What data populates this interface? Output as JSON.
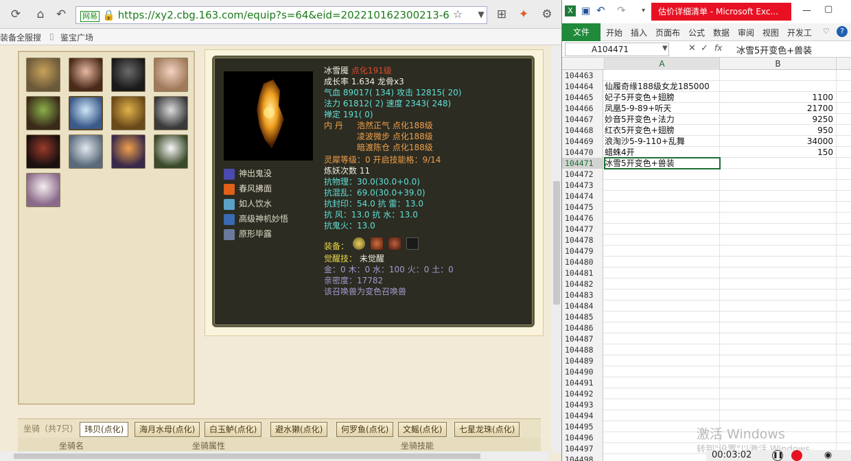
{
  "browser": {
    "url": "https://xy2.cbg.163.com/equip?s=64&eid=202210162300213-6",
    "url_badge": "网易",
    "bookmarks": [
      "装备全服搜",
      "鉴宝广场"
    ]
  },
  "pet": {
    "name": "冰雪魇",
    "level": "点化191级",
    "growth": "成长率 1.634 龙骨x3",
    "hp_label": "气血",
    "hp": "89017( 134)",
    "atk_label": "攻击",
    "atk": "12815( 20)",
    "mp_label": "法力",
    "mp": "61812( 2)",
    "spd_label": "速度",
    "spd": "2343( 248)",
    "zen": "禅定 191( 0)",
    "neidan_label": "内 丹",
    "neidan": [
      "浩然正气 点化188级",
      "凌波微步 点化188级",
      "暗渡陈仓 点化188级"
    ],
    "lingxi": "灵犀等级：0 开启技能格：9/14",
    "lianyao": "炼妖次数 11",
    "resist": [
      "抗物理：30.0(30.0+0.0)",
      "抗混乱：69.0(30.0+39.0)",
      "抗封印：54.0 抗  雷：13.0",
      "抗  风：13.0 抗  水：13.0",
      "抗鬼火：13.0"
    ],
    "equip_label": "装备：",
    "awaken_label": "觉醒技：",
    "awaken_value": "未觉醒",
    "elements": "金：0 木：0 水：100 火：0 土：0",
    "intimacy": "亲密度：17782",
    "note": "该召唤兽为变色召唤兽",
    "skills": [
      "神出鬼没",
      "春风拂面",
      "如人饮水",
      "高级神机妙悟",
      "原形毕露"
    ]
  },
  "mounts": {
    "header_title": "坐骑（共7只）",
    "tabs": [
      "玮贝(点化)",
      "海月水母(点化)",
      "白玉鲈(点化)",
      "避水獭(点化)",
      "何罗鱼(点化)",
      "文鳐(点化)",
      "七星龙珠(点化)"
    ],
    "columns": [
      "坐骑名",
      "坐骑属性",
      "坐骑技能"
    ]
  },
  "excel": {
    "title": "估价详细清单 - Microsoft Exc...",
    "ribbon": [
      "文件",
      "开始",
      "插入",
      "页面布",
      "公式",
      "数据",
      "审阅",
      "视图",
      "开发工"
    ],
    "name_box": "A104471",
    "formula": "冰雪5开变色+兽装",
    "col_a": "A",
    "col_b": "B",
    "rows": [
      {
        "n": "104463",
        "a": "",
        "b": ""
      },
      {
        "n": "104464",
        "a": "仙履奇缘188级女龙185000",
        "b": ""
      },
      {
        "n": "104465",
        "a": "妃子5开变色+翅膀",
        "b": "1100"
      },
      {
        "n": "104466",
        "a": "凤凰5-9-89+听天",
        "b": "21700"
      },
      {
        "n": "104467",
        "a": "妙音5开变色+法力",
        "b": "9250"
      },
      {
        "n": "104468",
        "a": "红衣5开变色+翅膀",
        "b": "950"
      },
      {
        "n": "104469",
        "a": "浪淘沙5-9-110+乱舞",
        "b": "34000"
      },
      {
        "n": "104470",
        "a": "蜡蛛4开",
        "b": "150"
      },
      {
        "n": "104471",
        "a": "冰雪5开变色+兽装",
        "b": ""
      },
      {
        "n": "104472",
        "a": "",
        "b": ""
      },
      {
        "n": "104473",
        "a": "",
        "b": ""
      },
      {
        "n": "104474",
        "a": "",
        "b": ""
      },
      {
        "n": "104475",
        "a": "",
        "b": ""
      },
      {
        "n": "104476",
        "a": "",
        "b": ""
      },
      {
        "n": "104477",
        "a": "",
        "b": ""
      },
      {
        "n": "104478",
        "a": "",
        "b": ""
      },
      {
        "n": "104479",
        "a": "",
        "b": ""
      },
      {
        "n": "104480",
        "a": "",
        "b": ""
      },
      {
        "n": "104481",
        "a": "",
        "b": ""
      },
      {
        "n": "104482",
        "a": "",
        "b": ""
      },
      {
        "n": "104483",
        "a": "",
        "b": ""
      },
      {
        "n": "104484",
        "a": "",
        "b": ""
      },
      {
        "n": "104485",
        "a": "",
        "b": ""
      },
      {
        "n": "104486",
        "a": "",
        "b": ""
      },
      {
        "n": "104487",
        "a": "",
        "b": ""
      },
      {
        "n": "104488",
        "a": "",
        "b": ""
      },
      {
        "n": "104489",
        "a": "",
        "b": ""
      },
      {
        "n": "104490",
        "a": "",
        "b": ""
      },
      {
        "n": "104491",
        "a": "",
        "b": ""
      },
      {
        "n": "104492",
        "a": "",
        "b": ""
      },
      {
        "n": "104493",
        "a": "",
        "b": ""
      },
      {
        "n": "104494",
        "a": "",
        "b": ""
      },
      {
        "n": "104495",
        "a": "",
        "b": ""
      },
      {
        "n": "104496",
        "a": "",
        "b": ""
      },
      {
        "n": "104497",
        "a": "",
        "b": ""
      },
      {
        "n": "104498",
        "a": "",
        "b": ""
      }
    ],
    "watermark": "激活 Windows",
    "watermark_sub": "转到\"设置\"以激活 Windows。",
    "record_time": "00:03:02"
  }
}
